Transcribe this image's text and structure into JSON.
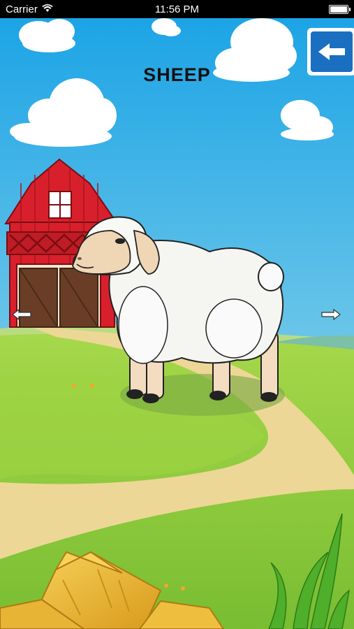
{
  "status_bar": {
    "carrier": "Carrier",
    "time": "11:56 PM",
    "wifi_icon": "wifi-icon",
    "battery_icon": "battery-icon"
  },
  "screen": {
    "animal_name": "SHEEP"
  },
  "icons": {
    "back": "back-arrow-icon",
    "previous": "left-arrow-icon",
    "next": "right-arrow-icon"
  },
  "colors": {
    "sky_top": "#1aa4e6",
    "sky_bottom": "#c8ecd0",
    "grass": "#8cc83c",
    "path": "#ecd79a",
    "barn_red": "#d8202c",
    "back_button_blue": "#1a6fc0"
  }
}
